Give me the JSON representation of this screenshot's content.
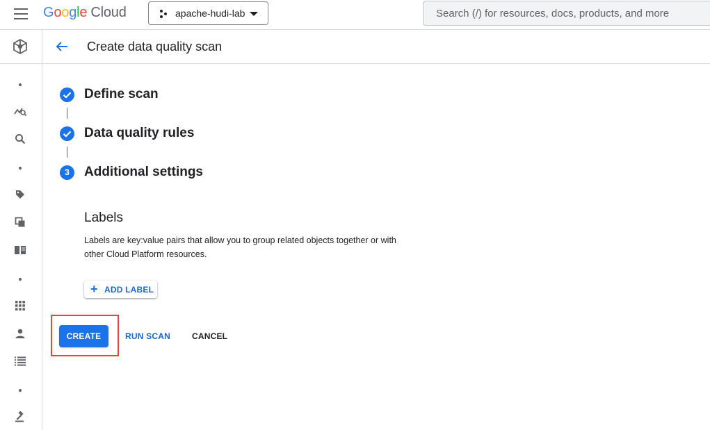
{
  "topbar": {
    "logo_letters": [
      "G",
      "o",
      "o",
      "g",
      "l",
      "e"
    ],
    "logo_suffix": "Cloud",
    "project_name": "apache-hudi-lab",
    "search_placeholder": "Search (/) for resources, docs, products, and more"
  },
  "rail": {
    "icons": [
      "dataplex-icon",
      "dot",
      "data-profile-icon",
      "search-icon",
      "dot",
      "tag-icon",
      "copy-icon",
      "book-icon",
      "dot",
      "apps-grid-icon",
      "person-icon",
      "list-icon",
      "dot",
      "gavel-icon"
    ]
  },
  "header": {
    "title": "Create data quality scan"
  },
  "stepper": {
    "steps": [
      {
        "label": "Define scan",
        "state": "complete"
      },
      {
        "label": "Data quality rules",
        "state": "complete"
      },
      {
        "label": "Additional settings",
        "state": "active",
        "number": "3"
      }
    ]
  },
  "labels_section": {
    "title": "Labels",
    "description": "Labels are key:value pairs that allow you to group related objects together or with other Cloud Platform resources.",
    "add_button": "ADD LABEL"
  },
  "actions": {
    "create": "CREATE",
    "run_scan": "RUN SCAN",
    "cancel": "CANCEL"
  },
  "colors": {
    "accent": "#1a73e8",
    "highlight": "#ea4335"
  }
}
